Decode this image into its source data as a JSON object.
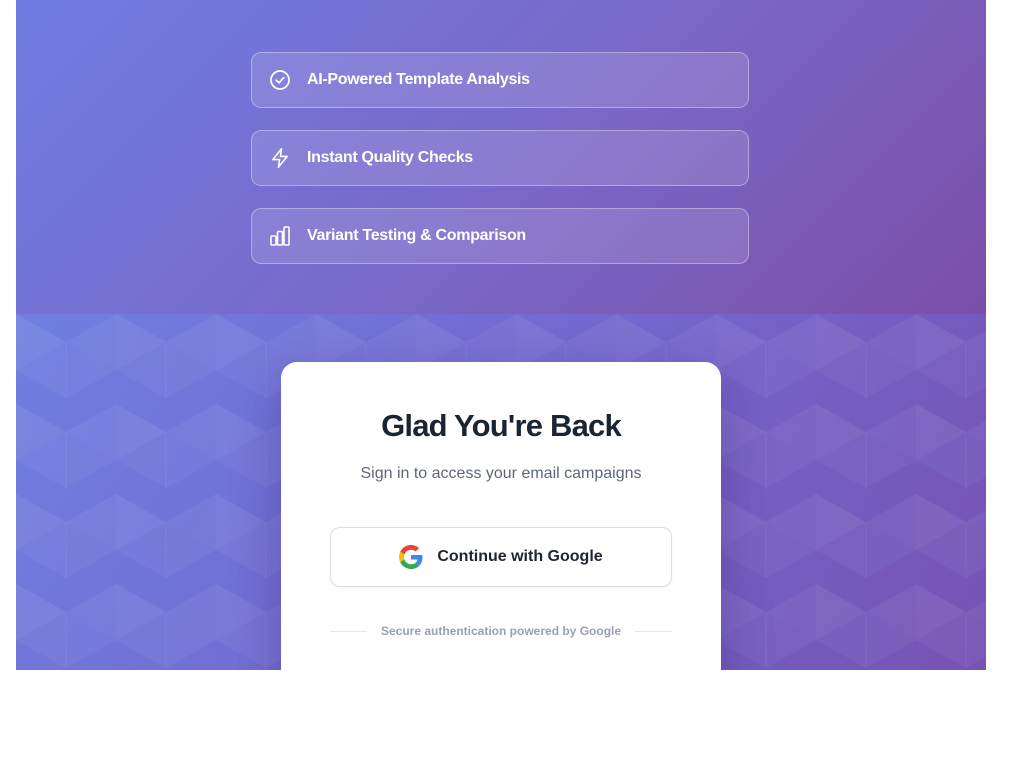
{
  "features": [
    {
      "label": "AI-Powered Template Analysis",
      "icon": "check-circle-icon"
    },
    {
      "label": "Instant Quality Checks",
      "icon": "lightning-bolt-icon"
    },
    {
      "label": "Variant Testing & Comparison",
      "icon": "bar-chart-icon"
    }
  ],
  "login": {
    "title": "Glad You're Back",
    "subtitle": "Sign in to access your email campaigns",
    "google_button_label": "Continue with Google",
    "google_icon": "google-logo-icon",
    "secure_note": "Secure authentication powered by Google"
  },
  "colors": {
    "hero_gradient_start": "#6f7ce2",
    "hero_gradient_end": "#7b4ea8",
    "title_text": "#1b2433",
    "subtitle_text": "#5d6777",
    "card_background": "#ffffff"
  }
}
